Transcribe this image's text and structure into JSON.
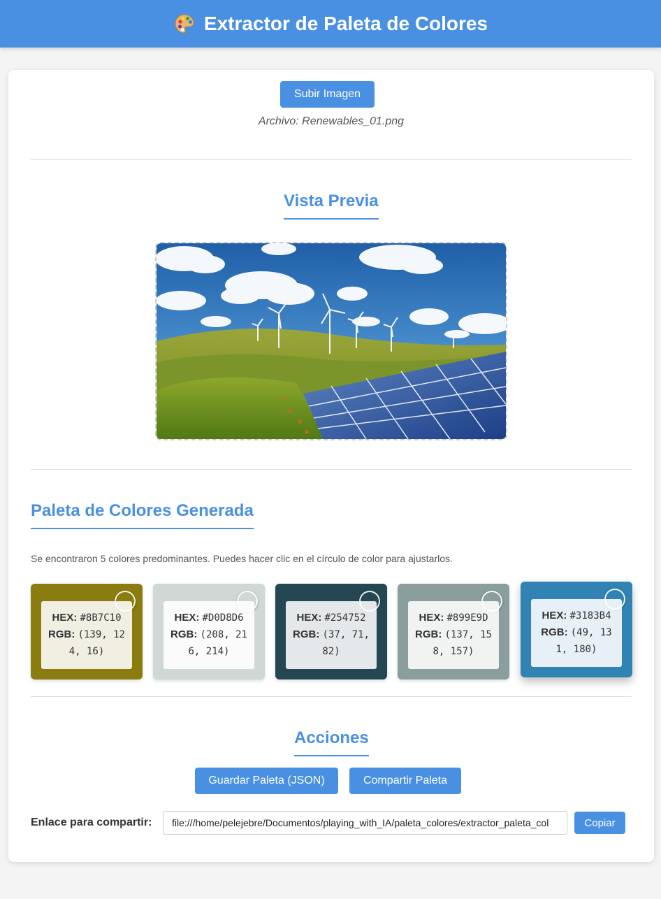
{
  "header": {
    "title": "Extractor de Paleta de Colores",
    "icon": "palette-icon"
  },
  "upload": {
    "button_label": "Subir Imagen",
    "filename_text": "Archivo: Renewables_01.png"
  },
  "preview": {
    "title": "Vista Previa",
    "image_subject": "wind-turbines-and-solar-panels"
  },
  "palette": {
    "title": "Paleta de Colores Generada",
    "info": "Se encontraron 5 colores predominantes. Puedes hacer clic en el círculo de color para ajustarlos.",
    "hex_label": "HEX:",
    "rgb_label": "RGB:",
    "colors": [
      {
        "hex": "#8B7C10",
        "rgb": "(139, 124, 16)"
      },
      {
        "hex": "#D0D8D6",
        "rgb": "(208, 216, 214)"
      },
      {
        "hex": "#254752",
        "rgb": "(37, 71, 82)"
      },
      {
        "hex": "#899E9D",
        "rgb": "(137, 158, 157)"
      },
      {
        "hex": "#3183B4",
        "rgb": "(49, 131, 180)"
      }
    ]
  },
  "actions": {
    "title": "Acciones",
    "save_label": "Guardar Paleta (JSON)",
    "share_label": "Compartir Paleta",
    "share_link_label": "Enlace para compartir:",
    "share_link_value": "file:///home/pelejebre/Documentos/playing_with_IA/paleta_colores/extractor_paleta_col",
    "copy_label": "Copiar"
  },
  "colors": {
    "accent": "#4a90e2",
    "background": "#f4f4f4"
  }
}
